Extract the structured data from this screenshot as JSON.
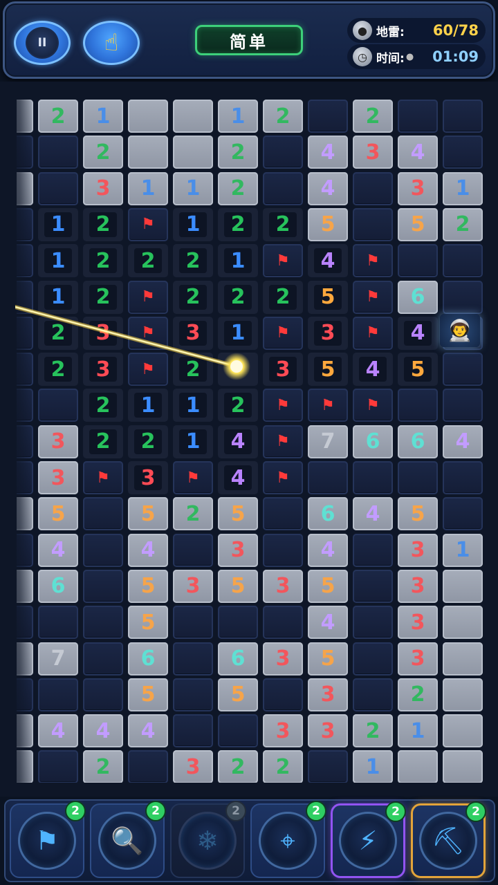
{
  "top_bar": {
    "pause_icon": "pause-icon",
    "hand_icon": "hand-pointer-icon",
    "difficulty": "简单",
    "mines_label": "地雷:",
    "mines_value": "60/78",
    "time_label": "时间:",
    "time_value": "01:09"
  },
  "board": {
    "cells": [
      [
        "L",
        "L2",
        "L1",
        "L",
        "L",
        "L1",
        "L2",
        "C",
        "L2",
        "C",
        "C"
      ],
      [
        "C",
        "C",
        "L2",
        "L",
        "L",
        "L2",
        "C",
        "L4",
        "L3",
        "L4",
        "C"
      ],
      [
        "L",
        "C",
        "L3",
        "L1",
        "L1",
        "L2",
        "C",
        "L4",
        "C",
        "L3",
        "L1"
      ],
      [
        "C",
        "1",
        "2",
        "F",
        "1",
        "2",
        "2",
        "L5",
        "C",
        "L5",
        "L2"
      ],
      [
        "C",
        "1",
        "2",
        "2",
        "2",
        "1",
        "F",
        "4",
        "F",
        "C",
        "C"
      ],
      [
        "C",
        "1",
        "2",
        "F",
        "2",
        "2",
        "2",
        "5",
        "F",
        "L6",
        "C"
      ],
      [
        "C",
        "2",
        "3",
        "F",
        "3",
        "1",
        "F",
        "3",
        "F",
        "4",
        "A"
      ],
      [
        "C",
        "2",
        "3",
        "F",
        "2",
        "B",
        "3",
        "5",
        "4",
        "5",
        "C"
      ],
      [
        "C",
        "C",
        "2",
        "1",
        "1",
        "2",
        "F",
        "F",
        "F",
        "C",
        "C"
      ],
      [
        "C",
        "L3",
        "2",
        "2",
        "1",
        "4",
        "F",
        "L7",
        "L6",
        "L6",
        "L4"
      ],
      [
        "C",
        "L3",
        "F",
        "3",
        "F",
        "4",
        "F",
        "C",
        "C",
        "C",
        "C"
      ],
      [
        "L",
        "L5",
        "C",
        "L5",
        "L2",
        "L5",
        "C",
        "L6",
        "L4",
        "L5",
        "C"
      ],
      [
        "C",
        "L4",
        "C",
        "L4",
        "C",
        "L3",
        "C",
        "L4",
        "C",
        "L3",
        "L1"
      ],
      [
        "L",
        "L6",
        "C",
        "L5",
        "L3",
        "L5",
        "L3",
        "L5",
        "C",
        "L3",
        "L"
      ],
      [
        "C",
        "C",
        "C",
        "L5",
        "C",
        "C",
        "C",
        "L4",
        "C",
        "L3",
        "L"
      ],
      [
        "L",
        "L7",
        "C",
        "L6",
        "C",
        "L6",
        "L3",
        "L5",
        "C",
        "L3",
        "L"
      ],
      [
        "C",
        "C",
        "C",
        "L5",
        "C",
        "L5",
        "C",
        "L3",
        "C",
        "L2",
        "L"
      ],
      [
        "L",
        "L4",
        "L4",
        "L4",
        "C",
        "C",
        "L3",
        "L3",
        "L2",
        "L1",
        "L"
      ],
      [
        "L",
        "C",
        "L2",
        "C",
        "L3",
        "L2",
        "L2",
        "C",
        "L1",
        "L",
        "L"
      ]
    ]
  },
  "tools": [
    {
      "name": "flag-tool",
      "icon": "flag-icon",
      "glyph": "⚑",
      "count": "2",
      "state": "normal"
    },
    {
      "name": "magnifier-tool",
      "icon": "magnifier-icon",
      "glyph": "🔍",
      "count": "2",
      "state": "normal"
    },
    {
      "name": "freeze-tool",
      "icon": "snowflake-icon",
      "glyph": "❄",
      "count": "2",
      "state": "disabled"
    },
    {
      "name": "target-tool",
      "icon": "crosshair-icon",
      "glyph": "⌖",
      "count": "2",
      "state": "normal"
    },
    {
      "name": "lightning-tool",
      "icon": "lightning-icon",
      "glyph": "⚡",
      "count": "2",
      "state": "purple"
    },
    {
      "name": "shovel-tool",
      "icon": "shovel-icon",
      "glyph": "⛏",
      "count": "2",
      "state": "gold"
    }
  ],
  "colors": {
    "num1": "#3b8cff",
    "num2": "#27c25c",
    "num3": "#ff4b55",
    "num4": "#b983ff",
    "num5": "#ffa83d",
    "num6": "#48dcc9",
    "flag": "#ff3a3a",
    "laser": "#ffd84a"
  }
}
